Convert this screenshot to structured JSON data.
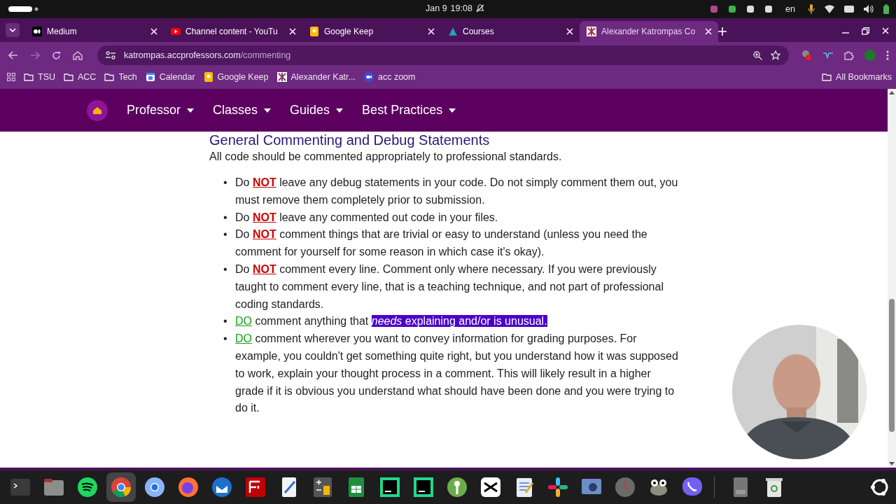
{
  "top_bar": {
    "date": "Jan 9",
    "time": "19:08",
    "language": "en"
  },
  "tabs": [
    {
      "title": "Medium",
      "kind": "medium",
      "selected": false
    },
    {
      "title": "Channel content - YouTu",
      "kind": "youtube",
      "selected": false
    },
    {
      "title": "Google Keep",
      "kind": "keep",
      "selected": false
    },
    {
      "title": "Courses",
      "kind": "courses",
      "selected": false
    },
    {
      "title": "Alexander Katrompas Co",
      "kind": "site",
      "selected": true
    }
  ],
  "address_bar": {
    "domain": "katrompas.accprofessors.com",
    "path": "/commenting"
  },
  "bookmarks": [
    {
      "label": "TSU",
      "kind": "folder"
    },
    {
      "label": "ACC",
      "kind": "folder"
    },
    {
      "label": "Tech",
      "kind": "folder"
    },
    {
      "label": "Calendar",
      "kind": "calendar"
    },
    {
      "label": "Google Keep",
      "kind": "keep"
    },
    {
      "label": "Alexander Katr...",
      "kind": "site"
    },
    {
      "label": "acc zoom",
      "kind": "zoom"
    }
  ],
  "all_bookmarks": "All Bookmarks",
  "site_nav": [
    "Professor",
    "Classes",
    "Guides",
    "Best Practices"
  ],
  "heading": "General Commenting and Debug Statements",
  "intro": "All code should be commented appropriately to professional standards.",
  "rules": [
    {
      "bullet": "•",
      "prefix": "Do",
      "mark": "NOT",
      "kind": "not",
      "text": "leave any debug statements in your code. Do not simply comment them out, you must remove them completely prior to submission."
    },
    {
      "bullet": "•",
      "prefix": "Do",
      "mark": "NOT",
      "kind": "not",
      "text": "leave any commented out code in your files."
    },
    {
      "bullet": "•",
      "prefix": "Do",
      "mark": "NOT",
      "kind": "not",
      "text": "comment things that are trivial or easy to understand (unless you need the comment for yourself for some reason in which case it's okay)."
    },
    {
      "bullet": "•",
      "prefix": "Do",
      "mark": "NOT",
      "kind": "not",
      "text": "comment every line. Comment only where necessary. If you were previously taught to comment every line, that is a teaching technique, and not part of professional coding standards."
    },
    {
      "bullet": "•",
      "mark": "DO",
      "kind": "do",
      "text": "comment anything that",
      "highlighted": "*needs* explaining and/or is unusual."
    },
    {
      "bullet": "•",
      "mark": "DO",
      "kind": "do",
      "text": "comment wherever you want to convey information for grading purposes. For example, you couldn't get something quite right, but you understand how it was supposed to work, explain your thought process in a comment. This will likely result in a higher grade if it is obvious you understand what should have been done and you were trying to do it."
    }
  ],
  "webcam": {
    "kind": "picture"
  },
  "taskbar": [
    {
      "kind": "terminal",
      "selected": false
    },
    {
      "kind": "files",
      "selected": false
    },
    {
      "kind": "spotify",
      "selected": false
    },
    {
      "kind": "chrome",
      "selected": true
    },
    {
      "kind": "chromium",
      "selected": false
    },
    {
      "kind": "firefox",
      "selected": false
    },
    {
      "kind": "thunderbird",
      "selected": false
    },
    {
      "kind": "filezilla",
      "selected": false
    },
    {
      "kind": "editor",
      "selected": false
    },
    {
      "kind": "calculator",
      "selected": false
    },
    {
      "kind": "sheet",
      "selected": false
    },
    {
      "kind": "pycharm",
      "selected": false
    },
    {
      "kind": "clion",
      "selected": false
    },
    {
      "kind": "keepass",
      "selected": false
    },
    {
      "kind": "capcut",
      "selected": false
    },
    {
      "kind": "notes",
      "selected": false
    },
    {
      "kind": "slack",
      "selected": false
    },
    {
      "kind": "screen",
      "selected": false
    },
    {
      "kind": "clock",
      "selected": false
    },
    {
      "kind": "gimp",
      "selected": false
    },
    {
      "kind": "viber",
      "selected": false
    },
    {
      "kind": "drive",
      "selected": false
    },
    {
      "kind": "trash",
      "selected": false
    },
    {
      "kind": "ubuntu",
      "selected": false
    }
  ]
}
